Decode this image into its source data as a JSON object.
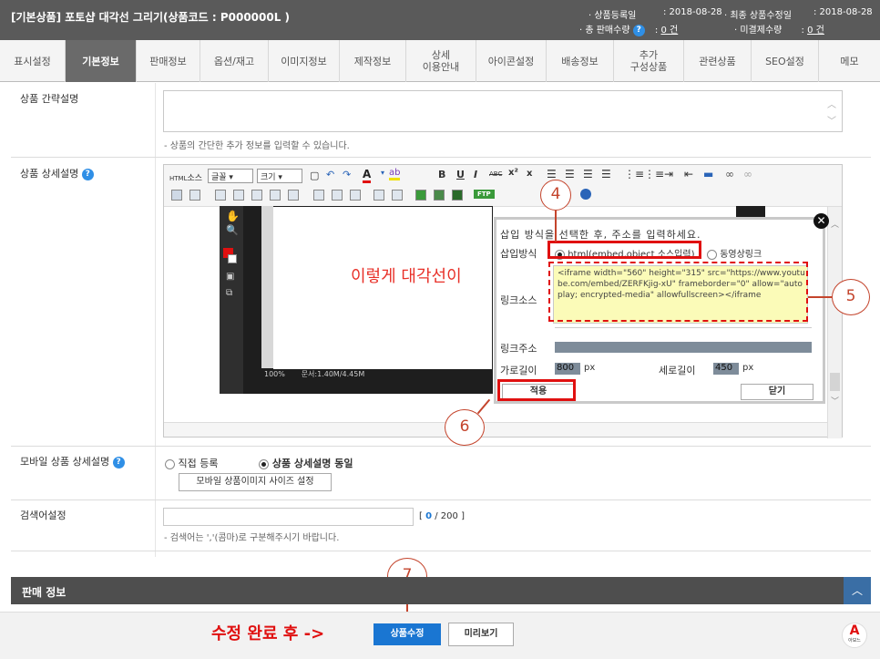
{
  "header": {
    "title": "[기본상품] 포토샵 대각선 그리기(상품코드 : P000000L )",
    "reg_label": "· 상품등록일",
    "reg_date": ": 2018-08-28",
    "mod_label": "· 최종 상품수정일",
    "mod_date": ": 2018-08-28",
    "sales_label": "· 총 판매수량",
    "sales_value": "0 건",
    "unpaid_label": "· 미결제수량",
    "unpaid_value": "0 건"
  },
  "tabs": [
    {
      "label": "표시설정"
    },
    {
      "label": "기본정보"
    },
    {
      "label": "판매정보"
    },
    {
      "label": "옵션/재고"
    },
    {
      "label": "이미지정보"
    },
    {
      "label": "제작정보"
    },
    {
      "label": "상세\n이용안내"
    },
    {
      "label": "아이콘설정"
    },
    {
      "label": "배송정보"
    },
    {
      "label": "추가\n구성상품"
    },
    {
      "label": "관련상품"
    },
    {
      "label": "SEO설정"
    },
    {
      "label": "메모"
    }
  ],
  "short_desc": {
    "label": "상품 간략설명",
    "hint": "- 상품의 간단한 추가 정보를 입력할 수 있습니다."
  },
  "detail_desc": {
    "label": "상품 상세설명"
  },
  "editor": {
    "html_label": "HTML",
    "source_label": "소스",
    "font_label": "글꼴",
    "size_label": "크기",
    "ftp_label": "FTP",
    "abc_label": "ABC"
  },
  "editor_content": {
    "overlay_text": "이렇게 대각선이",
    "status_zoom": "100%",
    "status_doc": "문서:1.40M/4.45M"
  },
  "dialog": {
    "title": "삽입 방식을 선택한 후, 주소를 입력하세요.",
    "method_label": "삽입방식",
    "option_html": "html(embed,object 소스입력)",
    "option_video": "동영상링크",
    "source_label": "링크소스",
    "source_code": "<iframe width=\"560\" height=\"315\" src=\"https://www.youtube.com/embed/ZERFKjig-xU\" frameborder=\"0\" allow=\"autoplay; encrypted-media\" allowfullscreen></iframe",
    "url_label": "링크주소",
    "width_label": "가로길이",
    "width_value": "800",
    "width_unit": "px",
    "height_label": "세로길이",
    "height_value": "450",
    "height_unit": "px",
    "apply_label": "적용",
    "close_label": "닫기"
  },
  "annotations": {
    "step4": "4",
    "step5": "5",
    "step6": "6",
    "step7": "7",
    "bottom_note": "수정 완료 후 ->"
  },
  "mobile": {
    "label": "모바일 상품 상세설명",
    "opt1": "직접 등록",
    "opt2": "상품 상세설명 동일",
    "size_btn": "모바일 상품이미지 사이즈 설정"
  },
  "search": {
    "label": "검색어설정",
    "counter_open": "[",
    "counter_value": "0",
    "counter_total": "/ 200 ]",
    "hint": "- 검색어는 ','(콤마)로 구분해주시기 바랍니다."
  },
  "sales_section": {
    "title": "판매 정보"
  },
  "footer": {
    "save_label": "상품수정",
    "preview_label": "미리보기",
    "logo_text": "아보느"
  },
  "colors": {
    "accent": "#e01010",
    "primary_button": "#1a76d2",
    "annotation": "#c4442c"
  }
}
